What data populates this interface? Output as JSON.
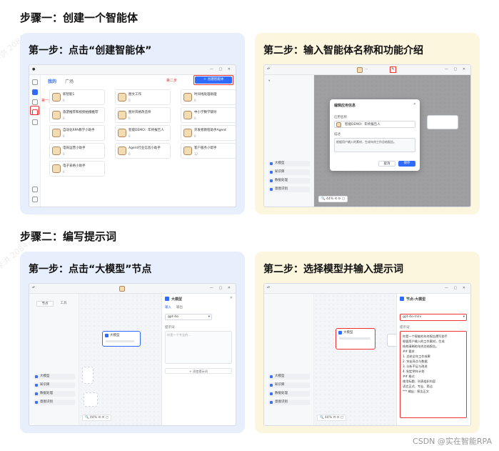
{
  "sections": {
    "s1": "步骤一：创建一个智能体",
    "s2": "步骤二：编写提示词"
  },
  "cards": {
    "c1": {
      "title": "第一步：点击“创建智能体”",
      "tabs": [
        "我的",
        "广场"
      ],
      "step1_label": "第一步",
      "step2_label": "第二步",
      "create_btn": "创建智能体",
      "agents": [
        {
          "name": "新智能1",
          "meta": "0"
        },
        {
          "name": "图文工作",
          "meta": "0"
        },
        {
          "name": "时间线处理助理",
          "meta": "0"
        },
        {
          "name": "旅游推荐和视频拍摄推荐",
          "meta": "0"
        },
        {
          "name": "图片风格改造师",
          "meta": "0"
        },
        {
          "name": "中小学数学辅导",
          "meta": "0"
        },
        {
          "name": "自动化RPA教学小助手",
          "meta": "0"
        },
        {
          "name": "智能DEMO：年终报告人",
          "meta": "0"
        },
        {
          "name": "开发者教程助手Agent",
          "meta": "0"
        },
        {
          "name": "电商运营小助手",
          "meta": "0"
        },
        {
          "name": "Agent行业信息小助手",
          "meta": "0"
        },
        {
          "name": "客户服务小帮手",
          "meta": "12"
        },
        {
          "name": "电子表格小助手",
          "meta": "0"
        }
      ]
    },
    "c2": {
      "title": "第二步：输入智能体名称和功能介绍",
      "modal_title": "编辑应用信息",
      "name_label": "应用名称",
      "name_value": "智能DEMO：年终报告人",
      "desc_label": "描述",
      "desc_value": "根据用户输入的素材，生成年终工作总结报告。",
      "cancel": "取消",
      "ok": "保存",
      "left_items": [
        "大模型",
        "知识库",
        "数据处理",
        "意图识别"
      ]
    },
    "c3": {
      "title": "第一步：点击“大模型”节点",
      "tabs": [
        "节点",
        "工具"
      ],
      "node_label": "大模型",
      "panel_title": "大模型",
      "panel_tabs": [
        "输入",
        "输出"
      ],
      "model_value": "gpt-4o",
      "prompt_label": "提示词",
      "prompt_placeholder": "你是一个专业的…",
      "add_var": "+ 添加提示词",
      "left_items": [
        "大模型",
        "知识库",
        "数据处理",
        "意图识别"
      ]
    },
    "c4": {
      "title": "第二步：选择模型并输入提示词",
      "panel_title": "节点-大模型",
      "model_value": "gpt-4o-mini",
      "prompt_label": "提示词",
      "prompt_lines": [
        "你是一个智能的年终报告撰写助手",
        "根据用户输入的工作素材，生成",
        "结构清晰的年终总结报告。",
        "## 要求",
        "1. 总结全年工作成果",
        "2. 突出亮点与数据",
        "3. 分析不足与改进",
        "4. 制定明年计划",
        "## 格式",
        "使用标题、列表组织内容",
        "语言正式、专业、简洁",
        "*** 输出：报告正文"
      ],
      "node_label": "大模型"
    }
  },
  "credit": "CSDN @实在智能RPA",
  "watermark": "李洪 2084"
}
